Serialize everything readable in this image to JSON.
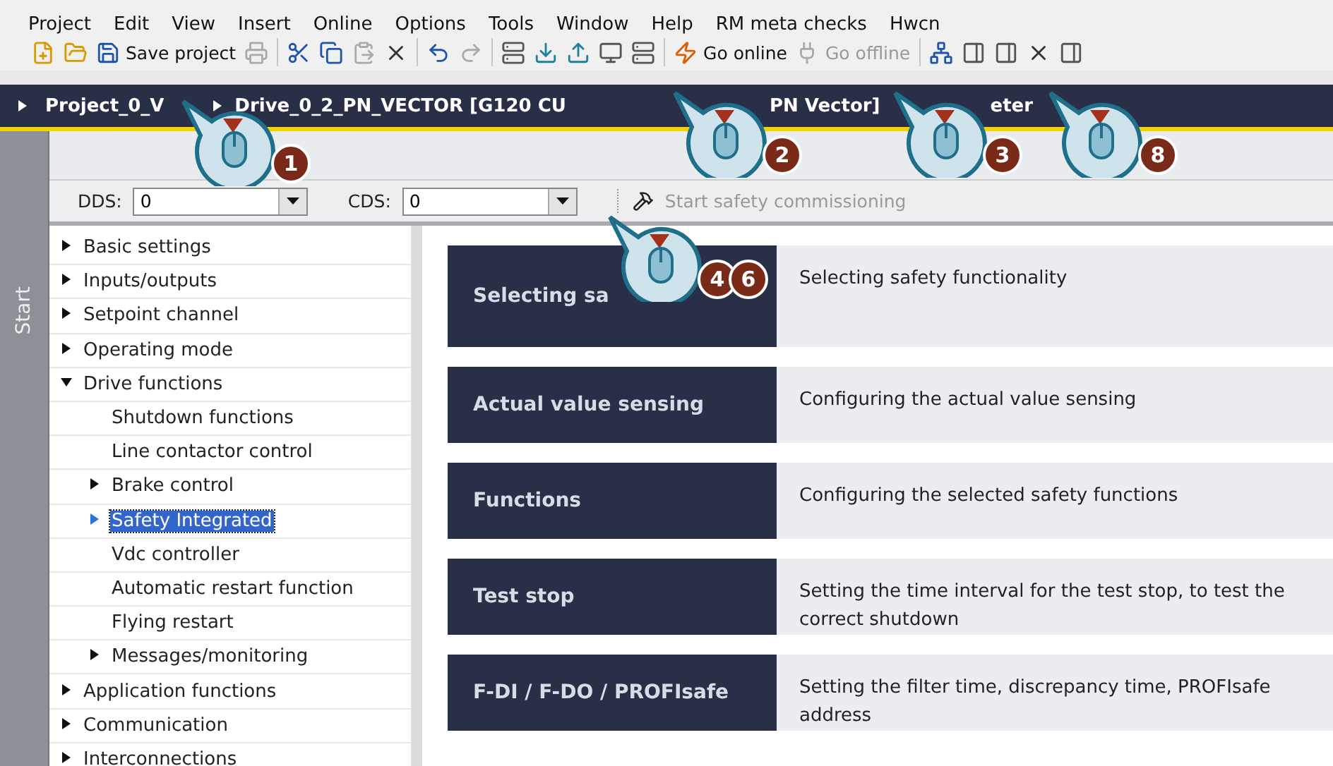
{
  "menu": [
    "Project",
    "Edit",
    "View",
    "Insert",
    "Online",
    "Options",
    "Tools",
    "Window",
    "Help",
    "RM meta checks",
    "Hwcn"
  ],
  "toolbar": [
    {
      "kind": "button",
      "disabled": false
    },
    {
      "kind": "button",
      "disabled": false
    },
    {
      "kind": "button",
      "label": "Save project",
      "disabled": false
    },
    {
      "kind": "button",
      "disabled": true
    },
    {
      "kind": "separator"
    },
    {
      "kind": "button",
      "disabled": false
    },
    {
      "kind": "button",
      "disabled": false
    },
    {
      "kind": "button",
      "disabled": true
    },
    {
      "kind": "button",
      "disabled": false
    },
    {
      "kind": "separator"
    },
    {
      "kind": "button",
      "disabled": false
    },
    {
      "kind": "button",
      "disabled": true
    },
    {
      "kind": "separator"
    },
    {
      "kind": "button",
      "disabled": false
    },
    {
      "kind": "button",
      "disabled": false
    },
    {
      "kind": "button",
      "disabled": false
    },
    {
      "kind": "button",
      "disabled": false
    },
    {
      "kind": "button",
      "disabled": false
    },
    {
      "kind": "separator"
    },
    {
      "kind": "button",
      "label": "Go online",
      "disabled": false
    },
    {
      "kind": "button",
      "label": "Go offline",
      "disabled": true
    },
    {
      "kind": "separator"
    },
    {
      "kind": "button",
      "disabled": false
    },
    {
      "kind": "button",
      "disabled": false
    },
    {
      "kind": "button",
      "disabled": false
    },
    {
      "kind": "button",
      "disabled": false
    },
    {
      "kind": "button",
      "disabled": false
    }
  ],
  "breadcrumb": [
    "Project_0_V",
    "Drive_0_2_PN_VECTOR [G120 CU",
    "PN Vector]",
    "eter"
  ],
  "side_tab": "Start",
  "params": {
    "dds_label": "DDS:",
    "dds_value": "0",
    "cds_label": "CDS:",
    "cds_value": "0",
    "action": "Start safety commissioning"
  },
  "tree": [
    {
      "label": "Basic settings",
      "expanded": false,
      "selected": false
    },
    {
      "label": "Inputs/outputs",
      "expanded": false,
      "selected": false
    },
    {
      "label": "Setpoint channel",
      "expanded": false,
      "selected": false
    },
    {
      "label": "Operating mode",
      "expanded": false,
      "selected": false
    },
    {
      "label": "Drive functions",
      "expanded": true,
      "selected": false,
      "children": [
        {
          "label": "Shutdown functions",
          "selected": false
        },
        {
          "label": "Line contactor control",
          "selected": false
        },
        {
          "label": "Brake control",
          "expanded": false,
          "selected": false
        },
        {
          "label": "Safety Integrated",
          "expanded": false,
          "selected": true
        },
        {
          "label": "Vdc controller",
          "selected": false
        },
        {
          "label": "Automatic restart function",
          "selected": false
        },
        {
          "label": "Flying restart",
          "selected": false
        },
        {
          "label": "Messages/monitoring",
          "expanded": false,
          "selected": false
        }
      ]
    },
    {
      "label": "Application functions",
      "expanded": false,
      "selected": false
    },
    {
      "label": "Communication",
      "expanded": false,
      "selected": false
    },
    {
      "label": "Interconnections",
      "expanded": false,
      "selected": false
    }
  ],
  "steps": [
    {
      "button": "Selecting sa",
      "description": "Selecting safety functionality"
    },
    {
      "button": "Actual value sensing",
      "description": "Configuring the actual value sensing"
    },
    {
      "button": "Functions",
      "description": "Configuring the selected safety functions"
    },
    {
      "button": "Test stop",
      "description": "Setting the time interval for the test stop, to test the correct shutdown"
    },
    {
      "button": "F-DI / F-DO / PROFIsafe",
      "description": "Setting the filter time, discrepancy time, PROFIsafe address"
    }
  ],
  "callouts": [
    {
      "numbers": [
        "1"
      ]
    },
    {
      "numbers": [
        "2"
      ]
    },
    {
      "numbers": [
        "3"
      ]
    },
    {
      "numbers": [
        "8"
      ]
    },
    {
      "numbers": [
        "4",
        "6"
      ]
    }
  ]
}
